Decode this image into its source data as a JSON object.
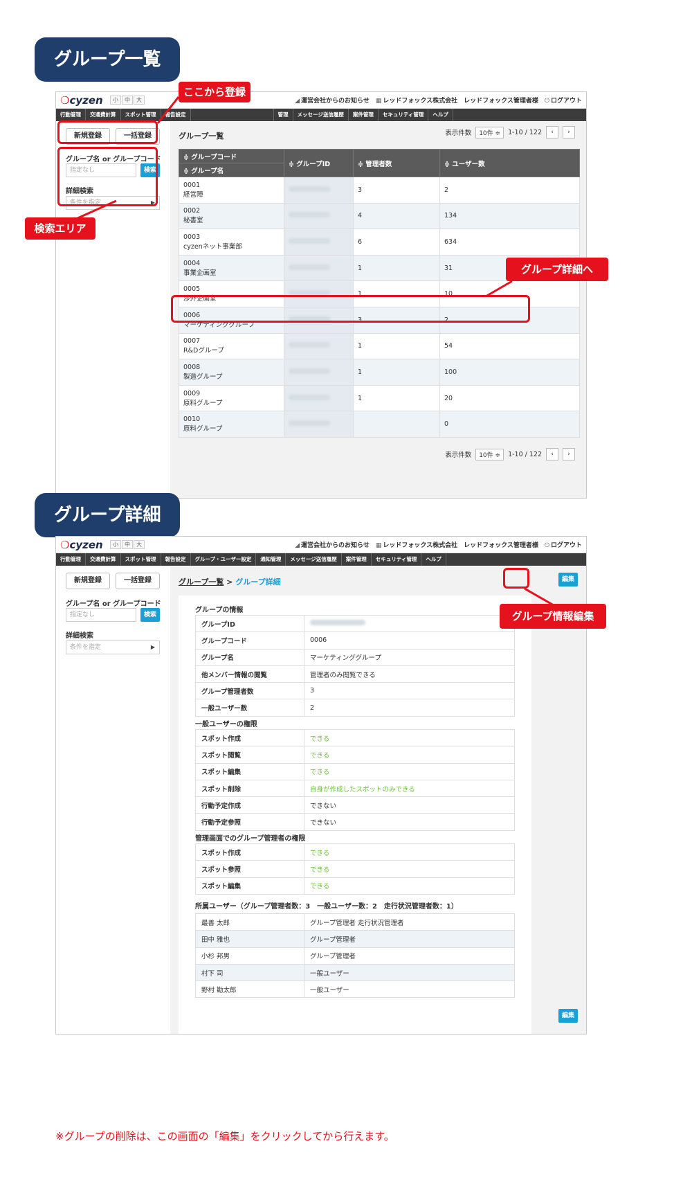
{
  "sections": {
    "list_title": "グループ一覧",
    "detail_title": "グループ詳細"
  },
  "app": {
    "logo": "cyzen",
    "font_sizes": [
      "小",
      "中",
      "大"
    ],
    "top_links": [
      "運営会社からのお知らせ",
      "レッドフォックス株式会社",
      "レッドフォックス管理者様",
      "ログアウト"
    ],
    "nav_items_list": [
      "行動管理",
      "交通費計算",
      "スポット管理",
      "報告設定",
      "",
      "",
      "",
      "管理",
      "メッセージ送信履歴",
      "案件管理",
      "セキュリティ管理",
      "ヘルプ"
    ],
    "nav_items_detail": [
      "行動管理",
      "交通費計算",
      "スポット管理",
      "報告設定",
      "グループ・ユーザー設定",
      "通知管理",
      "メッセージ送信履歴",
      "案件管理",
      "セキュリティ管理",
      "ヘルプ"
    ]
  },
  "sidebar": {
    "new_button": "新規登録",
    "bulk_button": "一括登録",
    "search_label": "グループ名 or グループコード",
    "search_placeholder": "指定なし",
    "search_button": "検索",
    "detail_search_label": "詳細検索",
    "condition_placeholder": "条件を指定"
  },
  "list": {
    "heading": "グループ一覧",
    "per_page_label": "表示件数",
    "per_page_value": "10件 ≑",
    "range": "1-10 / 122",
    "columns": [
      "≑ グループコード",
      "≑ グループ名",
      "≑ グループID",
      "≑ 管理者数",
      "≑ ユーザー数"
    ],
    "rows": [
      {
        "code": "0001",
        "name": "経営陣",
        "admins": "3",
        "users": "2"
      },
      {
        "code": "0002",
        "name": "秘書室",
        "admins": "4",
        "users": "134"
      },
      {
        "code": "0003",
        "name": "cyzenネット事業部",
        "admins": "6",
        "users": "634"
      },
      {
        "code": "0004",
        "name": "事業企画室",
        "admins": "1",
        "users": "31"
      },
      {
        "code": "0005",
        "name": "渉外企画室",
        "admins": "1",
        "users": "10"
      },
      {
        "code": "0006",
        "name": "マーケティンググループ",
        "admins": "3",
        "users": "2"
      },
      {
        "code": "0007",
        "name": "R&Dグループ",
        "admins": "1",
        "users": "54"
      },
      {
        "code": "0008",
        "name": "製造グループ",
        "admins": "1",
        "users": "100"
      },
      {
        "code": "0009",
        "name": "原料グループ",
        "admins": "1",
        "users": "20"
      },
      {
        "code": "0010",
        "name": "原料グループ",
        "admins": "",
        "users": "0"
      }
    ]
  },
  "callouts": {
    "register": "ここから登録",
    "search_area": "検索エリア",
    "to_detail": "グループ詳細へ",
    "edit_info": "グループ情報編集"
  },
  "detail": {
    "breadcrumb_parent": "グループ一覧",
    "breadcrumb_sep": " > ",
    "breadcrumb_current": "グループ詳細",
    "edit_button": "編集",
    "info_title": "グループの情報",
    "info_rows": [
      {
        "k": "グループID",
        "v": ""
      },
      {
        "k": "グループコード",
        "v": "0006"
      },
      {
        "k": "グループ名",
        "v": "マーケティンググループ"
      },
      {
        "k": "他メンバー情報の閲覧",
        "v": "管理者のみ閲覧できる"
      },
      {
        "k": "グループ管理者数",
        "v": "3"
      },
      {
        "k": "一般ユーザー数",
        "v": "2"
      }
    ],
    "user_perm_title": "一般ユーザーの権限",
    "user_perm_rows": [
      {
        "k": "スポット作成",
        "v": "できる"
      },
      {
        "k": "スポット閲覧",
        "v": "できる"
      },
      {
        "k": "スポット編集",
        "v": "できる"
      },
      {
        "k": "スポット削除",
        "v": "自身が作成したスポットのみできる"
      },
      {
        "k": "行動予定作成",
        "v": "できない"
      },
      {
        "k": "行動予定参照",
        "v": "できない"
      }
    ],
    "admin_perm_title": "管理画面でのグループ管理者の権限",
    "admin_perm_rows": [
      {
        "k": "スポット作成",
        "v": "できる"
      },
      {
        "k": "スポット参照",
        "v": "できる"
      },
      {
        "k": "スポット編集",
        "v": "できる"
      }
    ],
    "members_title": "所属ユーザー（グループ管理者数：3　一般ユーザー数：2　走行状況管理者数：1）",
    "members": [
      {
        "name": "最善 太郎",
        "role": "グループ管理者  走行状況管理者"
      },
      {
        "name": "田中 雅也",
        "role": "グループ管理者"
      },
      {
        "name": "小杉 邦男",
        "role": "グループ管理者"
      },
      {
        "name": "村下 司",
        "role": "一般ユーザー"
      },
      {
        "name": "野村 勘太郎",
        "role": "一般ユーザー"
      }
    ]
  },
  "note": "※グループの削除は、この画面の「編集」をクリックしてから行えます。",
  "colors": {
    "accent_red": "#e5121d",
    "navy": "#1f3e6b",
    "blue": "#1a9fd6",
    "ok_green": "#6cbf3f"
  }
}
